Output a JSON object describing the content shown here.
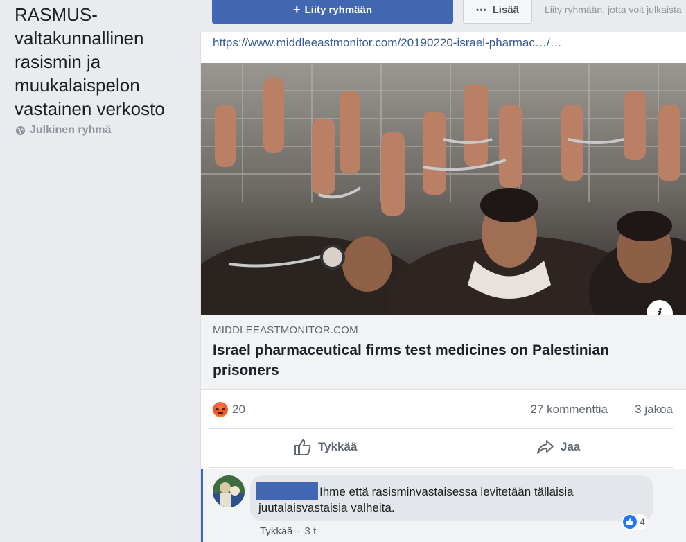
{
  "sidebar": {
    "group_name": "RASMUS-valtakunnallinen rasismin ja muukalaispelon vastainen verkosto",
    "group_type": "Julkinen ryhmä"
  },
  "top_bar": {
    "join_label": "Liity ryhmään",
    "more_label": "Lisää",
    "join_hint": "Liity ryhmään, jotta voit julkaista"
  },
  "post": {
    "link_url": "https://www.middleeastmonitor.com/20190220-israel-pharmac…/…",
    "link_domain": "MIDDLEEASTMONITOR.COM",
    "link_title": "Israel pharmaceutical firms test medicines on Palestinian prisoners",
    "reaction_count": "20",
    "comments_count": "27 kommenttia",
    "shares_count": "3 jakoa",
    "like_label": "Tykkää",
    "share_label": "Jaa"
  },
  "comment": {
    "text": "Ihme että rasisminvastaisessa levitetään tällaisia juutalaisvastaisia valheita.",
    "like_count": "4",
    "like_link": "Tykkää",
    "separator": "·",
    "time": "3 t"
  },
  "colors": {
    "brand_blue": "#4267b2",
    "link_blue": "#365899",
    "background": "#e9ebee"
  }
}
